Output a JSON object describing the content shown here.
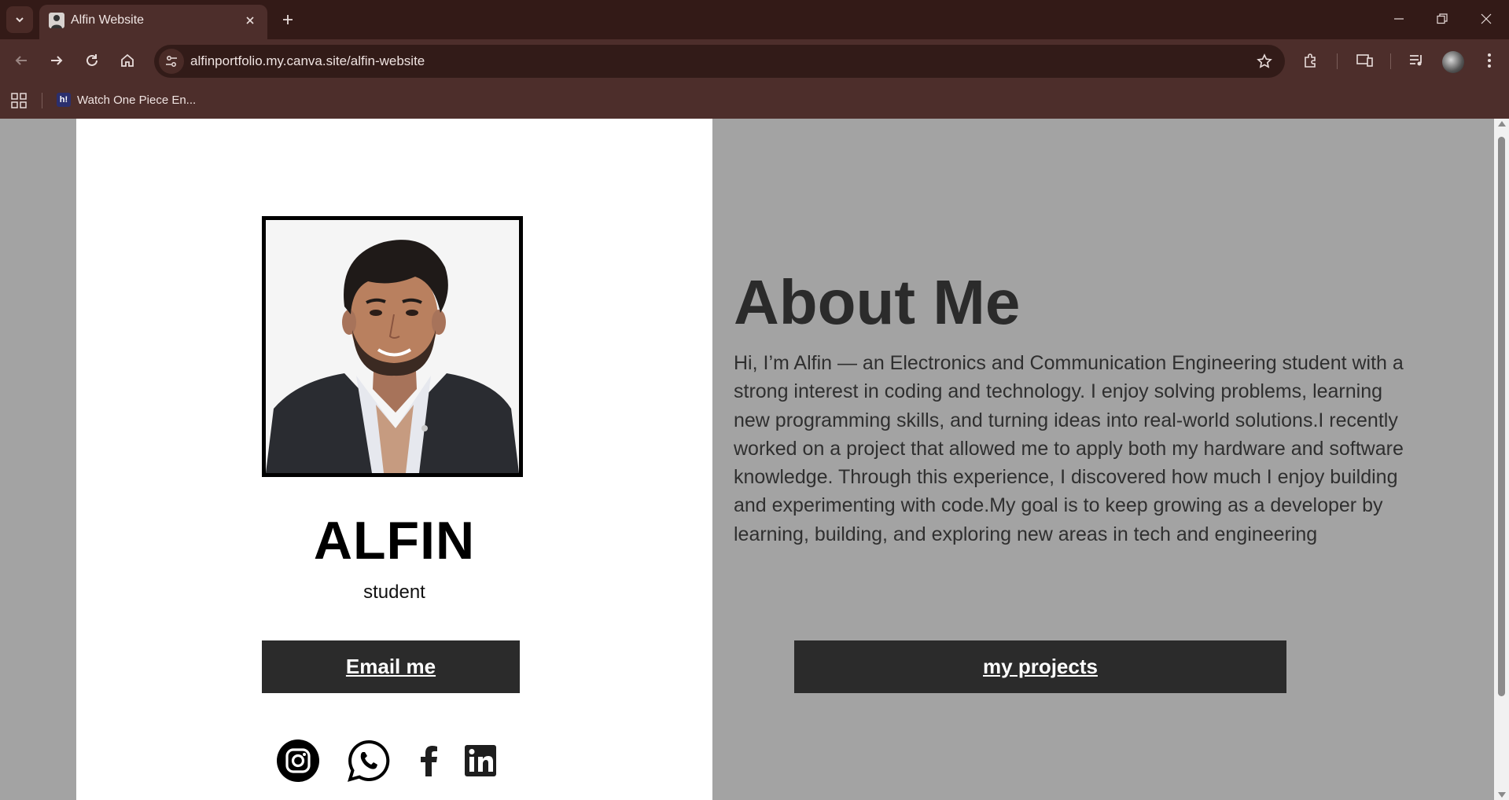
{
  "browser": {
    "tab_title": "Alfin Website",
    "url": "alfinportfolio.my.canva.site/alfin-website",
    "bookmark_label": "Watch One Piece En...",
    "bookmark_favicon_text": "h!",
    "theme_color": "#4d2e2b"
  },
  "profile": {
    "name": "ALFIN",
    "role": "student",
    "email_button": "Email me",
    "social_icons": [
      "instagram-icon",
      "whatsapp-icon",
      "facebook-icon",
      "linkedin-icon"
    ]
  },
  "about": {
    "title": "About Me",
    "text": "Hi, I’m Alfin — an Electronics and Communication Engineering student with a strong interest in coding and technology. I enjoy solving problems, learning new programming skills, and turning ideas into real-world solutions.I recently worked on a project that allowed me to apply both my hardware and software knowledge. Through this experience, I discovered how much I enjoy building and experimenting with code.My goal is to keep growing as a developer by learning, building, and exploring new areas in tech and engineering",
    "projects_button": "my projects"
  },
  "colors": {
    "left_bg": "#ffffff",
    "right_bg": "#a3a3a3",
    "button_bg": "#2b2b2b",
    "heading": "#2b2b2b"
  }
}
